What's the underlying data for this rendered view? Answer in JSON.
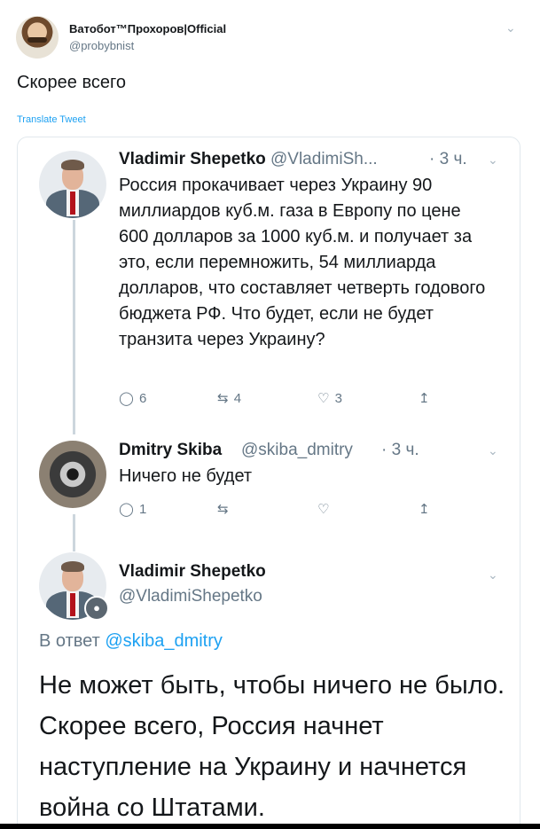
{
  "outer": {
    "name": "Ватобот™Прохоров|Official",
    "handle": "@probybnist",
    "text": "Скорее всего",
    "translate": "Translate Tweet"
  },
  "tweets": [
    {
      "name": "Vladimir Shepetko",
      "handle": "@VladimiSh...",
      "time": "· 3 ч.",
      "text": "Россия прокачивает через Украину 90 миллиардов куб.м. газа в Европу по цене 600 долларов за 1000 куб.м. и получает за это, если перемножить, 54 миллиарда долларов, что составляет четверть годового бюджета РФ. Что будет, если не будет транзита через Украину?",
      "replies": "6",
      "retweets": "4",
      "likes": "3"
    },
    {
      "name": "Dmitry Skiba",
      "handle": "@skiba_dmitry",
      "time": "· 3 ч.",
      "text": "Ничего не будет",
      "replies": "1"
    },
    {
      "name": "Vladimir Shepetko",
      "handle": "@VladimiShepetko",
      "reply_prefix": "В ответ",
      "reply_to": "@skiba_dmitry",
      "text": "Не может быть, чтобы ничего не было. Скорее всего, Россия начнет наступление на Украину и начнется война со Штатами."
    }
  ],
  "icons": {
    "reply": "reply-icon",
    "retweet": "retweet-icon",
    "like": "heart-icon",
    "share": "share-icon",
    "menu": "chevron-down-icon",
    "badge": "microphone-icon"
  }
}
